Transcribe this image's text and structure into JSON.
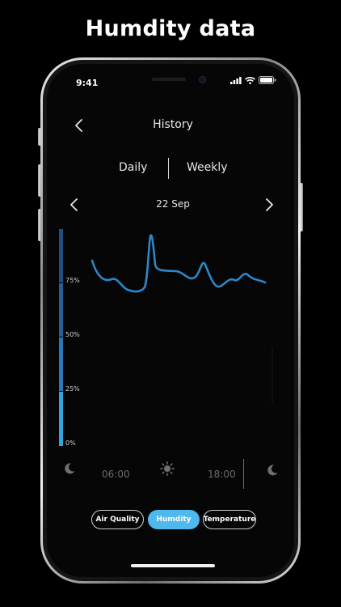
{
  "headline": "Humdity data",
  "status": {
    "time": "9:41"
  },
  "nav": {
    "title": "History"
  },
  "segments": {
    "daily": "Daily",
    "weekly": "Weekly"
  },
  "date": {
    "label": "22 Sep"
  },
  "scale": {
    "labels": [
      "75%",
      "50%",
      "25%",
      "0%"
    ],
    "colors": [
      "#1f4f7e",
      "#23609a",
      "#2a78b9",
      "#34a4df"
    ]
  },
  "timeline": {
    "morning": "06:00",
    "evening": "18:00"
  },
  "tabs": {
    "air_quality": "Air Quality",
    "humidity": "Humdity",
    "temperature": "Temperature"
  },
  "colors": {
    "accent": "#4fb8ec",
    "line": "#2e86c8"
  },
  "icons": [
    "back-chevron-icon",
    "chevron-left-icon",
    "chevron-right-icon",
    "moon-icon",
    "sun-icon",
    "signal-icon",
    "wifi-icon",
    "battery-icon"
  ]
}
